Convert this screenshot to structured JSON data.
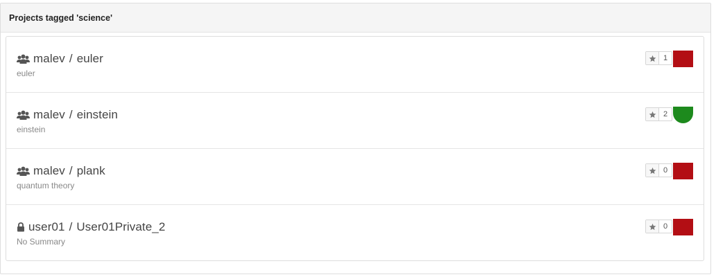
{
  "panel": {
    "heading": "Projects tagged 'science'"
  },
  "projects": [
    {
      "icon": "group-icon",
      "owner": "malev",
      "separator": "/",
      "name": "euler",
      "description": "euler",
      "stars": "1",
      "status": "failed",
      "status_color": "#b30e14"
    },
    {
      "icon": "group-icon",
      "owner": "malev",
      "separator": "/",
      "name": "einstein",
      "description": "einstein",
      "stars": "2",
      "status": "success",
      "status_color": "#1d8a1d"
    },
    {
      "icon": "group-icon",
      "owner": "malev",
      "separator": "/",
      "name": "plank",
      "description": "quantum theory",
      "stars": "0",
      "status": "failed",
      "status_color": "#b30e14"
    },
    {
      "icon": "lock-icon",
      "owner": "user01",
      "separator": "/",
      "name": "User01Private_2",
      "description": "No Summary",
      "stars": "0",
      "status": "failed",
      "status_color": "#b30e14"
    }
  ]
}
